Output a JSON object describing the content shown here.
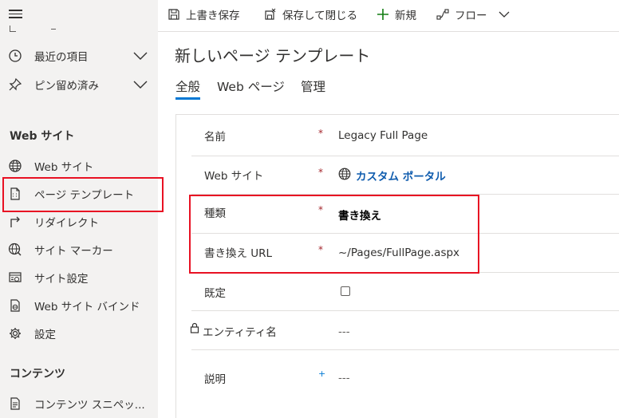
{
  "sidebar": {
    "items": [
      {
        "label": "最近の項目",
        "icon": "clock-icon"
      },
      {
        "label": "ピン留め済み",
        "icon": "pin-icon"
      }
    ],
    "web_section_title": "Web サイト",
    "web_items": [
      {
        "label": "Web サイト",
        "icon": "globe-icon"
      },
      {
        "label": "ページ テンプレート",
        "icon": "page-template-icon"
      },
      {
        "label": "リダイレクト",
        "icon": "redirect-icon"
      },
      {
        "label": "サイト マーカー",
        "icon": "globe-marker-icon"
      },
      {
        "label": "サイト設定",
        "icon": "site-settings-icon"
      },
      {
        "label": "Web サイト バインド",
        "icon": "website-binding-icon"
      },
      {
        "label": "設定",
        "icon": "gear-icon"
      }
    ],
    "content_section_title": "コンテンツ",
    "content_items": [
      {
        "label": "コンテンツ スニペッ...",
        "icon": "snippet-icon"
      }
    ]
  },
  "toolbar": {
    "save_label": "上書き保存",
    "save_close_label": "保存して閉じる",
    "new_label": "新規",
    "flow_label": "フロー"
  },
  "main": {
    "title": "新しいページ テンプレート",
    "tabs": [
      {
        "label": "全般",
        "active": true
      },
      {
        "label": "Web ページ"
      },
      {
        "label": "管理"
      }
    ]
  },
  "form": {
    "fields": [
      {
        "label": "名前",
        "required": "*",
        "value": "Legacy Full Page"
      },
      {
        "label": "Web サイト",
        "required": "*",
        "value": "カスタム ポータル"
      },
      {
        "label": "種類",
        "required": "*",
        "value": "書き換え"
      },
      {
        "label": "書き換え URL",
        "required": "*",
        "value": "~/Pages/FullPage.aspx"
      },
      {
        "label": "既定",
        "required": "",
        "value": ""
      },
      {
        "label": "エンティティ名",
        "required": "",
        "value": "---"
      },
      {
        "label": "説明",
        "required": "+",
        "value": "---"
      }
    ]
  },
  "colors": {
    "accent": "#0078d4",
    "highlight": "#e81123",
    "required": "#a4262c",
    "link": "#0f5cae"
  }
}
